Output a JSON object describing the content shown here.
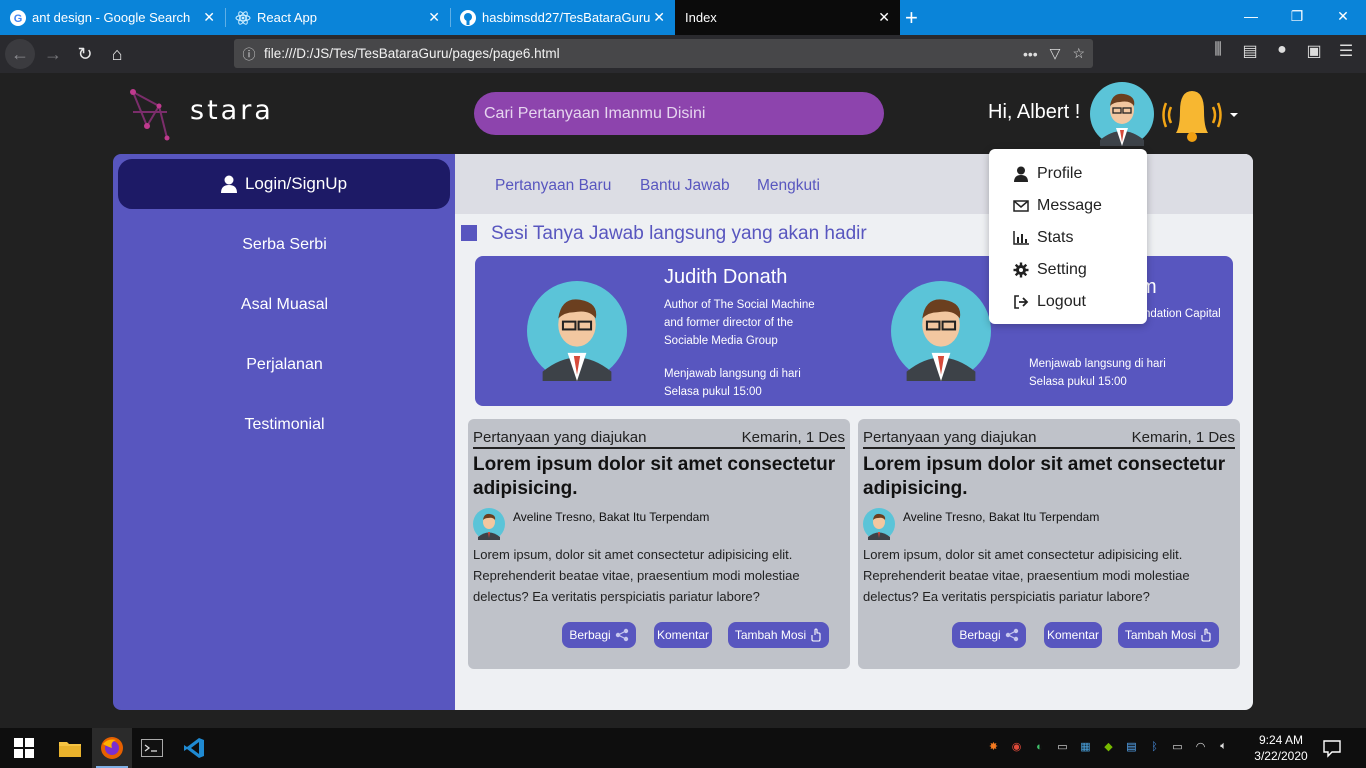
{
  "browser": {
    "tabs": [
      {
        "title": "ant design - Google Search",
        "icon": "google-icon"
      },
      {
        "title": "React App",
        "icon": "react-icon"
      },
      {
        "title": "hasbimsdd27/TesBataraGuru",
        "icon": "github-icon"
      },
      {
        "title": "Index",
        "icon": "none"
      }
    ],
    "url": "file:///D:/JS/Tes/TesBataraGuru/pages/page6.html",
    "colors": {
      "tabstrip": "#0a84d9",
      "toolbar": "#2a2a2e"
    }
  },
  "header": {
    "logo_text": "stara",
    "search_placeholder": "Cari Pertanyaan Imanmu Disini",
    "greeting": "Hi, Albert !"
  },
  "sidebar": {
    "login_label": "Login/SignUp",
    "items": [
      "Serba Serbi",
      "Asal Muasal",
      "Perjalanan",
      "Testimonial"
    ]
  },
  "main": {
    "tabs": [
      "Pertanyaan Baru",
      "Bantu Jawab",
      "Mengkuti"
    ],
    "section_title": "Sesi Tanya Jawab langsung yang akan hadir",
    "speakers": [
      {
        "name": "Judith Donath",
        "desc": "Author of The Social Machine and former director of the Sociable Media Group",
        "schedule": "Menjawab langsung di hari Selasa pukul 15:00"
      },
      {
        "name": "m",
        "desc": "ndation Capital",
        "schedule": "Menjawab langsung di hari Selasa pukul 15:00"
      }
    ],
    "questions": [
      {
        "label": "Pertanyaan yang diajukan",
        "date": "Kemarin, 1 Des",
        "title": "Lorem ipsum dolor sit amet consectetur adipisicing.",
        "author": "Aveline Tresno, Bakat Itu Terpendam",
        "body": "Lorem ipsum, dolor sit amet consectetur adipisicing elit. Reprehenderit beatae vitae, praesentium modi molestiae delectus? Ea veritatis perspiciatis pariatur labore?",
        "btn_share": "Berbagi",
        "btn_comment": "Komentar",
        "btn_vote": "Tambah Mosi"
      },
      {
        "label": "Pertanyaan yang diajukan",
        "date": "Kemarin, 1 Des",
        "title": "Lorem ipsum dolor sit amet consectetur adipisicing.",
        "author": "Aveline Tresno, Bakat Itu Terpendam",
        "body": "Lorem ipsum, dolor sit amet consectetur adipisicing elit. Reprehenderit beatae vitae, praesentium modi molestiae delectus? Ea veritatis perspiciatis pariatur labore?",
        "btn_share": "Berbagi",
        "btn_comment": "Komentar",
        "btn_vote": "Tambah Mosi"
      }
    ]
  },
  "dropdown": {
    "items": [
      {
        "label": "Profile",
        "icon": "user-icon"
      },
      {
        "label": "Message",
        "icon": "envelope-icon"
      },
      {
        "label": "Stats",
        "icon": "chart-icon"
      },
      {
        "label": "Setting",
        "icon": "gear-icon"
      },
      {
        "label": "Logout",
        "icon": "logout-icon"
      }
    ]
  },
  "taskbar": {
    "time": "9:24 AM",
    "date": "3/22/2020"
  },
  "colors": {
    "accent": "#5856bf",
    "sidebar_active": "#1d1a66",
    "search": "#8d44ad",
    "page_bg": "#212121",
    "card": "#bfc2c9"
  }
}
